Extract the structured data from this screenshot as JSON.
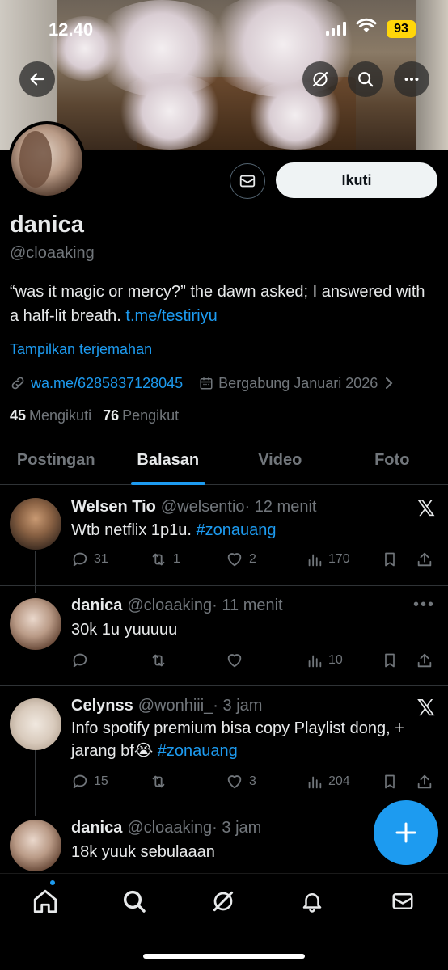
{
  "status_bar": {
    "time": "12.40",
    "battery": "93"
  },
  "profile": {
    "display_name": "danica",
    "handle": "@cloaaking",
    "bio_text": "“was it magic or mercy?” the dawn asked; I answered with a half-lit breath. ",
    "bio_link": "t.me/testiriyu",
    "translate_label": "Tampilkan terjemahan",
    "website": "wa.me/6285837128045",
    "joined": "Bergabung Januari 2026",
    "following_count": "45",
    "following_label": "Mengikuti",
    "followers_count": "76",
    "followers_label": "Pengikut",
    "follow_button": "Ikuti"
  },
  "tabs": [
    {
      "label": "Postingan",
      "active": false
    },
    {
      "label": "Balasan",
      "active": true
    },
    {
      "label": "Video",
      "active": false
    },
    {
      "label": "Foto",
      "active": false
    }
  ],
  "posts": [
    {
      "name": "Welsen Tio",
      "handle": "@welsentio",
      "time": "· 12 menit",
      "text": "Wtb netflix 1p1u. ",
      "hashtag": "#zonauang",
      "replies": "31",
      "reposts": "1",
      "likes": "2",
      "views": "170"
    },
    {
      "name": "danica",
      "handle": "@cloaaking",
      "time": "· 11 menit",
      "text": "30k 1u yuuuuu",
      "replies": "",
      "reposts": "",
      "likes": "",
      "views": "10"
    },
    {
      "name": "Celynss",
      "handle": "@wonhiii_",
      "time": "· 3 jam",
      "text": "Info spotify premium bisa copy Playlist dong, + jarang bf😭 ",
      "hashtag": "#zonauang",
      "replies": "15",
      "reposts": "",
      "likes": "3",
      "views": "204"
    },
    {
      "name": "danica",
      "handle": "@cloaaking",
      "time": "· 3 jam",
      "text": "18k yuuk sebulaaan"
    }
  ],
  "icons": {
    "back": "arrow-left-icon",
    "grok": "grok-icon",
    "search": "search-icon",
    "more": "more-icon",
    "mail": "mail-icon",
    "link": "link-icon",
    "calendar": "calendar-icon",
    "reply": "reply-icon",
    "repost": "repost-icon",
    "like": "heart-icon",
    "views": "views-icon",
    "bookmark": "bookmark-icon",
    "share": "share-icon",
    "x_logo": "x-logo-icon",
    "home": "home-icon",
    "bell": "bell-icon",
    "compose": "plus-icon"
  },
  "colors": {
    "accent": "#1d9bf0",
    "background": "#000000",
    "muted": "#71767b",
    "battery": "#ffd60a"
  }
}
